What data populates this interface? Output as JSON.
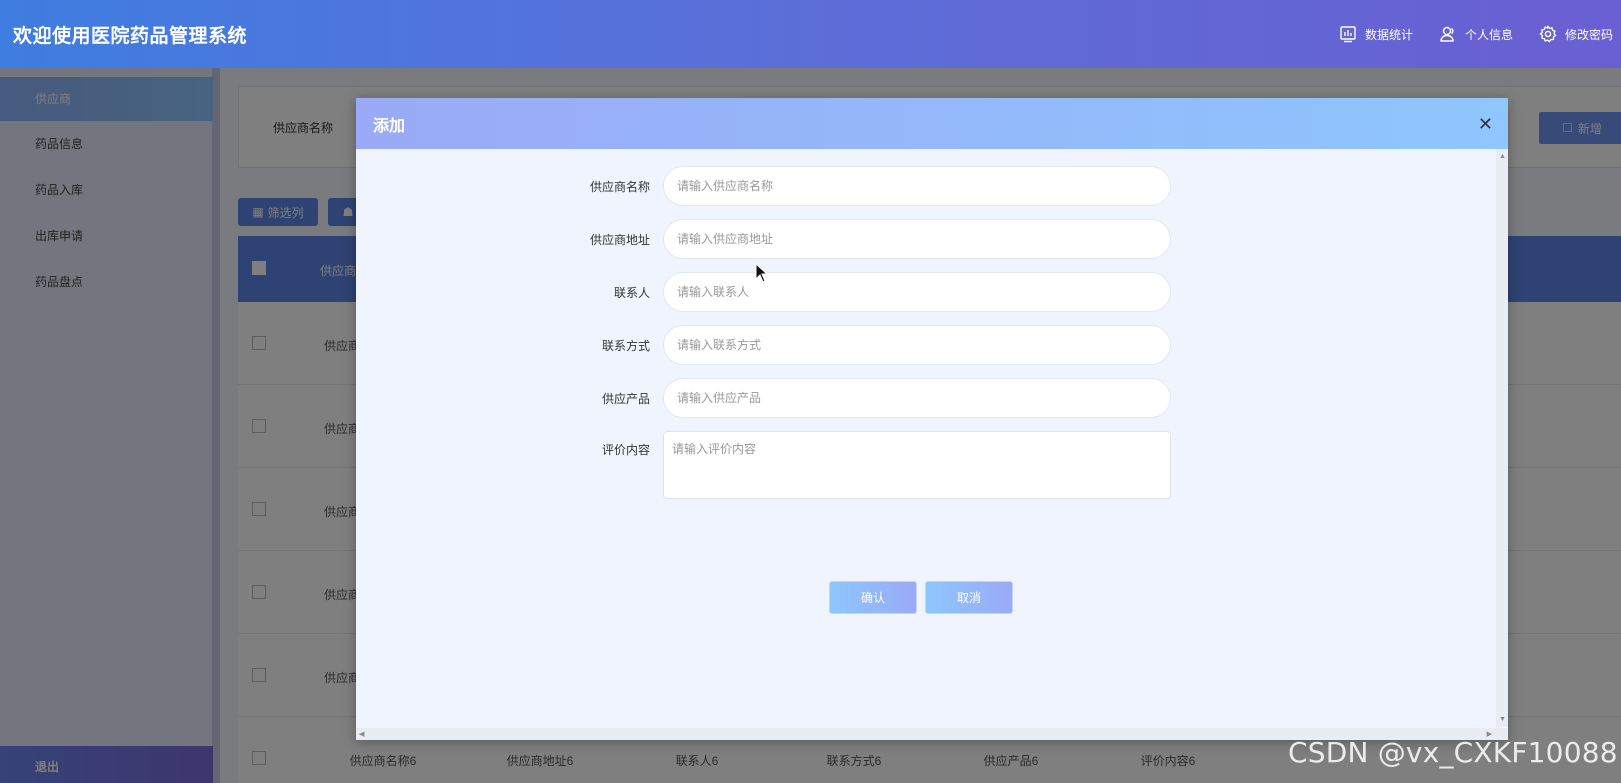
{
  "header": {
    "title": "欢迎使用医院药品管理系统",
    "actions": [
      {
        "label": "数据统计",
        "icon": "chart-icon"
      },
      {
        "label": "个人信息",
        "icon": "user-icon"
      },
      {
        "label": "修改密码",
        "icon": "gear-icon"
      }
    ]
  },
  "sidebar": {
    "items": [
      {
        "label": "供应商",
        "active": true
      },
      {
        "label": "药品信息"
      },
      {
        "label": "药品入库"
      },
      {
        "label": "出库申请"
      },
      {
        "label": "药品盘点"
      }
    ],
    "logout_label": "退出"
  },
  "background": {
    "search_label": "供应商名称",
    "add_label": "新增",
    "filter_label": "筛选列",
    "table_header_first": "供应商",
    "row_text": "供应商",
    "last_row": [
      "供应商名称6",
      "供应商地址6",
      "联系人6",
      "联系方式6",
      "供应产品6",
      "评价内容6"
    ]
  },
  "dialog": {
    "title": "添加",
    "fields": [
      {
        "label": "供应商名称",
        "placeholder": "请输入供应商名称"
      },
      {
        "label": "供应商地址",
        "placeholder": "请输入供应商地址"
      },
      {
        "label": "联系人",
        "placeholder": "请输入联系人"
      },
      {
        "label": "联系方式",
        "placeholder": "请输入联系方式"
      },
      {
        "label": "供应产品",
        "placeholder": "请输入供应产品"
      }
    ],
    "textarea": {
      "label": "评价内容",
      "placeholder": "请输入评价内容"
    },
    "confirm_label": "确认",
    "cancel_label": "取消"
  },
  "watermark": "CSDN @vx_CXKF10088"
}
